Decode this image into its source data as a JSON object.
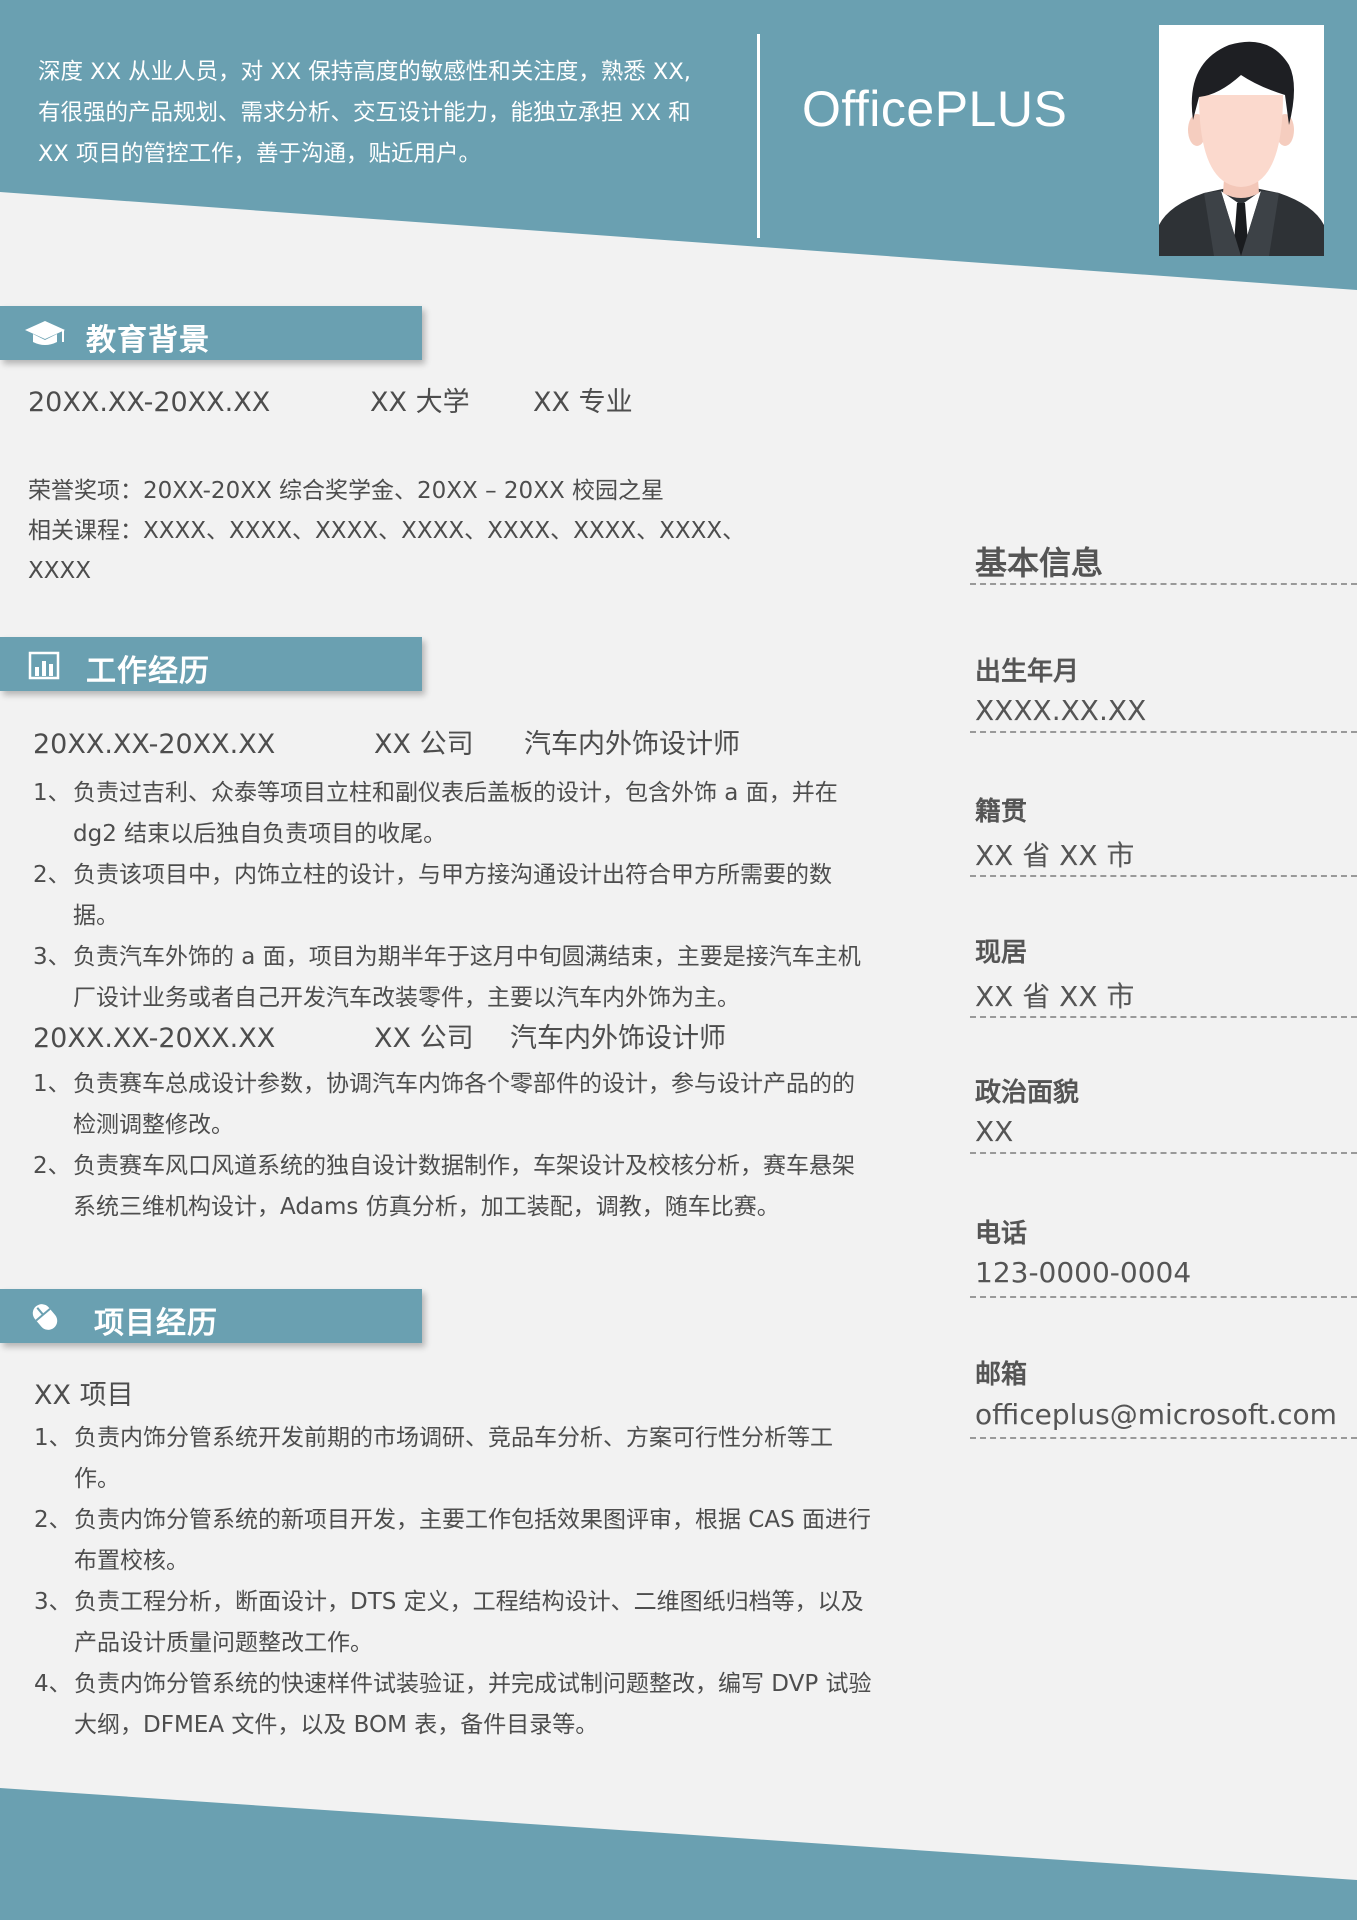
{
  "colors": {
    "accent": "#6aa0b1",
    "background": "#f2f2f2",
    "text": "#4d4d4d"
  },
  "header": {
    "summary_lines": [
      "深度 XX 从业人员，对 XX 保持高度的敏感性和关注度，熟悉 XX,",
      "有很强的产品规划、需求分析、交互设计能力，能独立承担 XX 和",
      "XX 项目的管控工作，善于沟通，贴近用户。"
    ],
    "name": "OfficePLUS",
    "photo_icon": "person-avatar"
  },
  "education": {
    "title": "教育背景",
    "icon": "graduation-cap-icon",
    "period": "20XX.XX-20XX.XX",
    "school": "XX 大学",
    "major": "XX 专业",
    "honors": "荣誉奖项：20XX-20XX 综合奖学金、20XX – 20XX 校园之星",
    "courses_line1": "相关课程：XXXX、XXXX、XXXX、XXXX、XXXX、XXXX、XXXX、",
    "courses_line2": "XXXX"
  },
  "work": {
    "title": "工作经历",
    "icon": "bar-chart-icon",
    "jobs": [
      {
        "period": "20XX.XX-20XX.XX",
        "company": "XX 公司",
        "role": "汽车内外饰设计师",
        "items": [
          {
            "num": "1、",
            "lines": [
              "负责过吉利、众泰等项目立柱和副仪表后盖板的设计，包含外饰 a 面，并在",
              "dg2 结束以后独自负责项目的收尾。"
            ]
          },
          {
            "num": "2、",
            "lines": [
              "负责该项目中，内饰立柱的设计，与甲方接沟通设计出符合甲方所需要的数",
              "据。"
            ]
          },
          {
            "num": "3、",
            "lines": [
              "负责汽车外饰的 a 面，项目为期半年于这月中旬圆满结束，主要是接汽车主机",
              "厂设计业务或者自己开发汽车改装零件，主要以汽车内外饰为主。"
            ]
          }
        ]
      },
      {
        "period": "20XX.XX-20XX.XX",
        "company": "XX 公司",
        "role": "汽车内外饰设计师",
        "items": [
          {
            "num": "1、",
            "lines": [
              "负责赛车总成设计参数，协调汽车内饰各个零部件的设计，参与设计产品的的",
              "检测调整修改。"
            ]
          },
          {
            "num": "2、",
            "lines": [
              "负责赛车风口风道系统的独自设计数据制作，车架设计及校核分析，赛车悬架",
              "系统三维机构设计，Adams 仿真分析，加工装配，调教，随车比赛。"
            ]
          }
        ]
      }
    ]
  },
  "projects": {
    "title": "项目经历",
    "icon": "mouse-icon",
    "name": "XX 项目",
    "items": [
      {
        "num": "1、",
        "lines": [
          "负责内饰分管系统开发前期的市场调研、竞品车分析、方案可行性分析等工",
          "作。"
        ]
      },
      {
        "num": "2、",
        "lines": [
          "负责内饰分管系统的新项目开发，主要工作包括效果图评审，根据 CAS 面进行",
          "布置校核。"
        ]
      },
      {
        "num": "3、",
        "lines": [
          "负责工程分析，断面设计，DTS 定义，工程结构设计、二维图纸归档等，以及",
          "产品设计质量问题整改工作。"
        ]
      },
      {
        "num": "4、",
        "lines": [
          "负责内饰分管系统的快速样件试装验证，并完成试制问题整改，编写 DVP 试验",
          "大纲，DFMEA 文件，以及 BOM 表，备件目录等。"
        ]
      }
    ]
  },
  "info": {
    "title": "基本信息",
    "fields": [
      {
        "label": "出生年月",
        "value": "XXXX.XX.XX"
      },
      {
        "label": "籍贯",
        "value": "XX 省 XX 市"
      },
      {
        "label": "现居",
        "value": "XX 省 XX 市"
      },
      {
        "label": "政治面貌",
        "value": "XX"
      },
      {
        "label": "电话",
        "value": "123-0000-0004"
      },
      {
        "label": "邮箱",
        "value": "officeplus@microsoft.com"
      }
    ]
  }
}
